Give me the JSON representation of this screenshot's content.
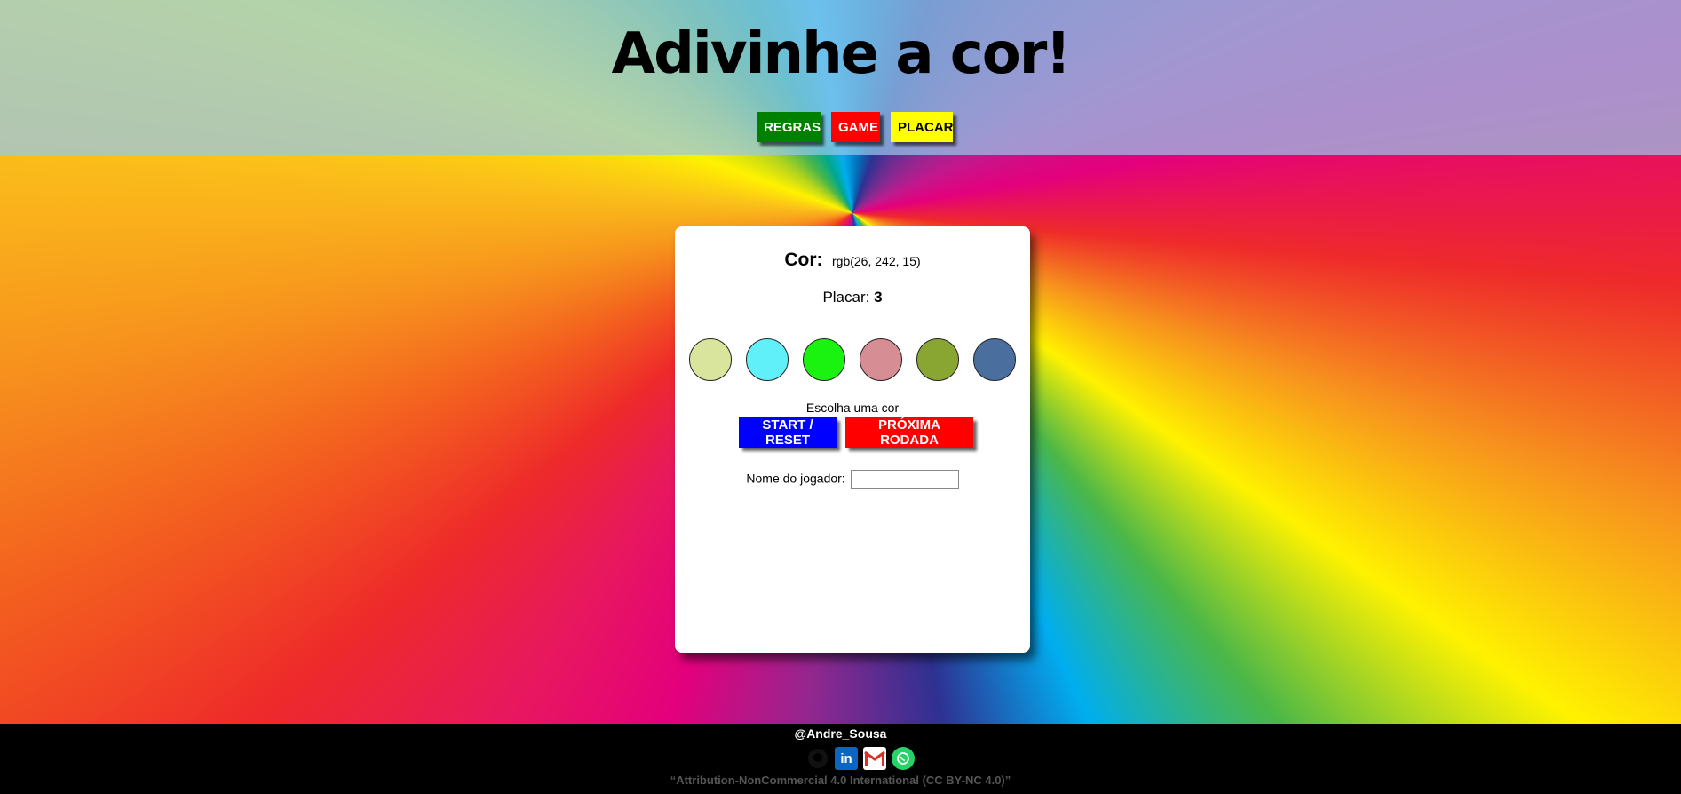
{
  "header": {
    "title": "Adivinhe a cor!",
    "nav": [
      {
        "label": "REGRAS",
        "color": "#008000"
      },
      {
        "label": "GAME",
        "color": "#ff0000"
      },
      {
        "label": "PLACAR",
        "color": "#ffff00"
      }
    ]
  },
  "game": {
    "cor_label": "Cor:",
    "cor_value": "rgb(26, 242, 15)",
    "placar_label": "Placar:",
    "placar_value": "3",
    "colors": [
      "#d9e59c",
      "#5ff0fa",
      "#1af20f",
      "#d68d93",
      "#8aa632",
      "#4a6e9e"
    ],
    "message": "Escolha uma cor",
    "start_label": "START / RESET",
    "next_label": "PRÓXIMA RODADA",
    "player_label": "Nome do jogador:",
    "player_value": ""
  },
  "footer": {
    "author": "@Andre_Sousa",
    "icons": [
      "github-icon",
      "linkedin-icon",
      "gmail-icon",
      "whatsapp-icon"
    ],
    "linkedin_text": "in",
    "license": "“Attribution-NonCommercial 4.0 International (CC BY-NC 4.0)”"
  }
}
